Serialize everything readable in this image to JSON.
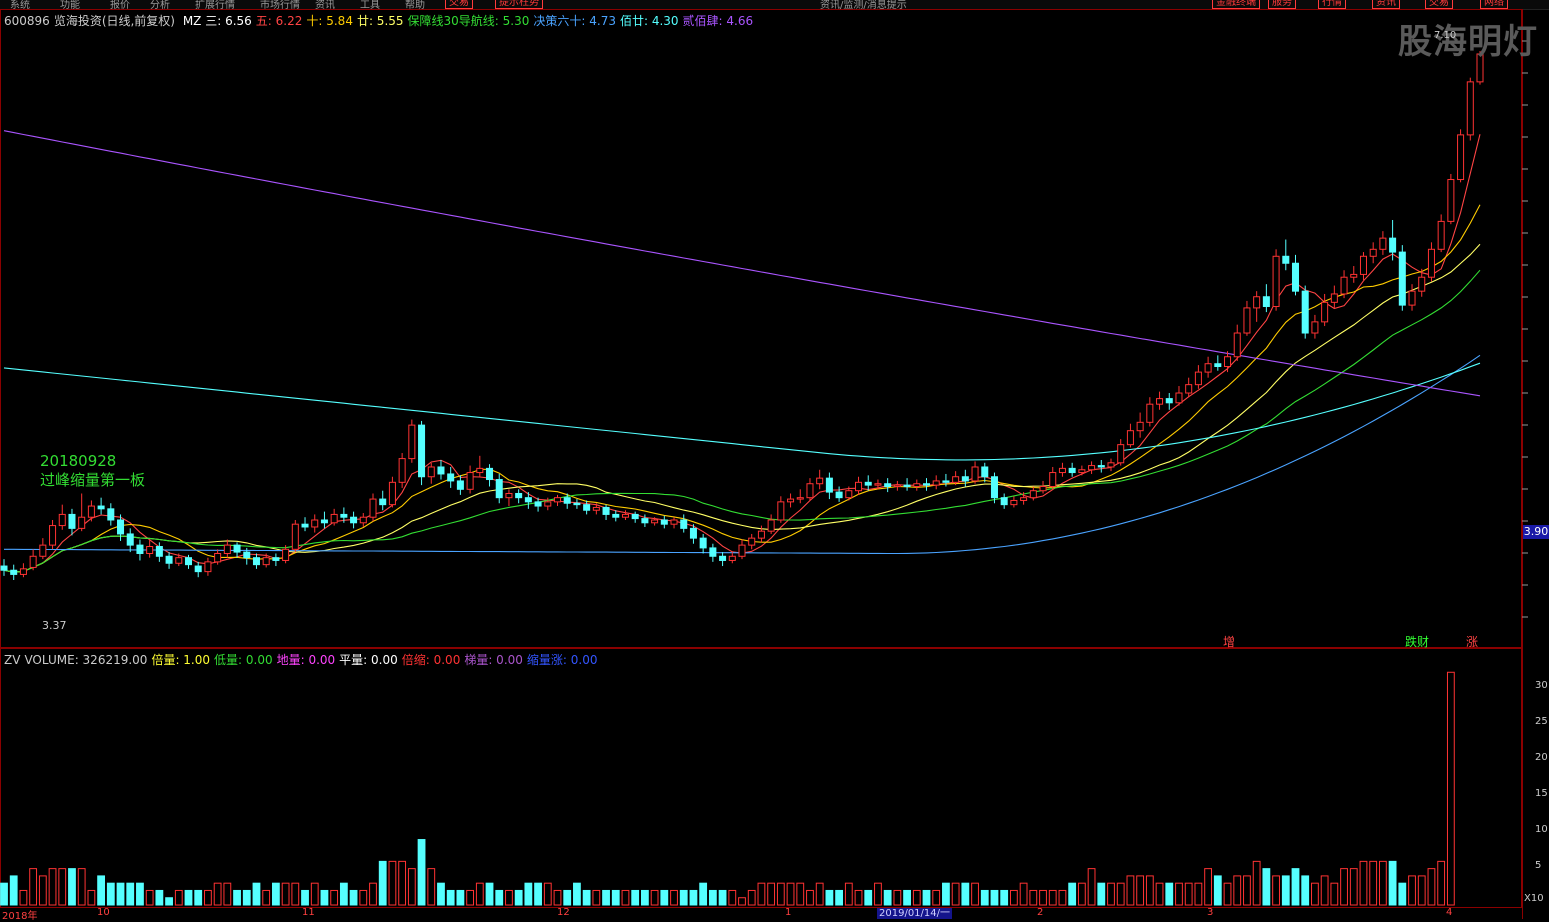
{
  "topbar": {
    "tabs": [
      "系统",
      "功能",
      "报价",
      "分析",
      "扩展行情",
      "市场行情",
      "资讯",
      "工具",
      "帮助",
      "交易",
      "提示柱势"
    ],
    "center_title": "资讯/监测/消息提示",
    "right_buttons": [
      "金融终端",
      "服务",
      "行情",
      "资讯",
      "交易",
      "网络"
    ]
  },
  "header": {
    "code": "600896",
    "name": "览海投资(日线,前复权)",
    "ma_items": [
      {
        "label": "MZ 三:",
        "value": "6.56",
        "color": "#ffffff"
      },
      {
        "label": "五:",
        "value": "6.22",
        "color": "#ff4444"
      },
      {
        "label": "十:",
        "value": "5.84",
        "color": "#ffcc00"
      },
      {
        "label": "廿:",
        "value": "5.55",
        "color": "#ffff66"
      },
      {
        "label": "保障线30导航线:",
        "value": "5.30",
        "color": "#33dd33"
      },
      {
        "label": "决策六十:",
        "value": "4.73",
        "color": "#4aa3ff"
      },
      {
        "label": "佰廿:",
        "value": "4.30",
        "color": "#55ffff"
      },
      {
        "label": "贰佰肆:",
        "value": "4.66",
        "color": "#aa55ff"
      }
    ]
  },
  "volume_header": {
    "items": [
      {
        "label": "ZV",
        "value": "",
        "color": "#cccccc"
      },
      {
        "label": "VOLUME:",
        "value": "326219.00",
        "color": "#cccccc"
      },
      {
        "label": "倍量:",
        "value": "1.00",
        "color": "#ffff33"
      },
      {
        "label": "低量:",
        "value": "0.00",
        "color": "#33dd33"
      },
      {
        "label": "地量:",
        "value": "0.00",
        "color": "#ff44ff"
      },
      {
        "label": "平量:",
        "value": "0.00",
        "color": "#ffffff"
      },
      {
        "label": "倍缩:",
        "value": "0.00",
        "color": "#ff3333"
      },
      {
        "label": "梯量:",
        "value": "0.00",
        "color": "#aa55cc"
      },
      {
        "label": "缩量涨:",
        "value": "0.00",
        "color": "#3355ff"
      }
    ]
  },
  "watermark": "股海明灯",
  "annotation": {
    "date": "20180928",
    "text": "过峰缩量第一板"
  },
  "markers": {
    "low_price": "3.37",
    "high_price": "7.10",
    "current_price": "3.90"
  },
  "signals": [
    {
      "text": "增",
      "color": "#ff4444"
    },
    {
      "text": "跌财",
      "color": "#33ff33"
    },
    {
      "text": "涨",
      "color": "#ff4444"
    }
  ],
  "cursor_date": "2019/01/14/一",
  "x_axis_labels": [
    "2018年",
    "10",
    "11",
    "12",
    "1",
    "2",
    "3",
    "4"
  ],
  "volume_axis": {
    "labels": [
      "5",
      "10",
      "15",
      "20",
      "25",
      "30"
    ],
    "unit": "X10"
  },
  "colors": {
    "up": "#ff3333",
    "down": "#55ffff",
    "grid": "#8b0000",
    "ma5": "#ff4444",
    "ma10": "#ffcc00",
    "ma20": "#ffff66",
    "ma30": "#33dd33",
    "ma60": "#4aa3ff",
    "ma120": "#55ffff",
    "ma240": "#aa55ff"
  },
  "chart_data": {
    "type": "candlestick",
    "title": "600896 览海投资(日线,前复权)",
    "ylim": [
      2.9,
      7.2
    ],
    "candles": [
      [
        3.43,
        3.4,
        3.48,
        3.36
      ],
      [
        3.4,
        3.37,
        3.44,
        3.33
      ],
      [
        3.37,
        3.41,
        3.45,
        3.35
      ],
      [
        3.42,
        3.5,
        3.55,
        3.4
      ],
      [
        3.5,
        3.58,
        3.63,
        3.48
      ],
      [
        3.58,
        3.72,
        3.76,
        3.55
      ],
      [
        3.72,
        3.8,
        3.87,
        3.69
      ],
      [
        3.8,
        3.7,
        3.84,
        3.65
      ],
      [
        3.7,
        3.78,
        3.95,
        3.68
      ],
      [
        3.78,
        3.86,
        3.9,
        3.75
      ],
      [
        3.86,
        3.84,
        3.92,
        3.8
      ],
      [
        3.84,
        3.76,
        3.88,
        3.72
      ],
      [
        3.76,
        3.66,
        3.8,
        3.61
      ],
      [
        3.66,
        3.58,
        3.7,
        3.53
      ],
      [
        3.58,
        3.52,
        3.62,
        3.47
      ],
      [
        3.52,
        3.57,
        3.62,
        3.49
      ],
      [
        3.57,
        3.5,
        3.6,
        3.46
      ],
      [
        3.5,
        3.45,
        3.53,
        3.41
      ],
      [
        3.45,
        3.49,
        3.52,
        3.43
      ],
      [
        3.49,
        3.44,
        3.51,
        3.41
      ],
      [
        3.43,
        3.39,
        3.46,
        3.35
      ],
      [
        3.39,
        3.46,
        3.49,
        3.36
      ],
      [
        3.46,
        3.52,
        3.55,
        3.44
      ],
      [
        3.52,
        3.58,
        3.62,
        3.49
      ],
      [
        3.58,
        3.53,
        3.6,
        3.49
      ],
      [
        3.53,
        3.49,
        3.56,
        3.44
      ],
      [
        3.49,
        3.44,
        3.52,
        3.41
      ],
      [
        3.44,
        3.49,
        3.52,
        3.42
      ],
      [
        3.49,
        3.47,
        3.52,
        3.43
      ],
      [
        3.47,
        3.55,
        3.58,
        3.45
      ],
      [
        3.55,
        3.73,
        3.76,
        3.53
      ],
      [
        3.73,
        3.71,
        3.78,
        3.68
      ],
      [
        3.71,
        3.76,
        3.8,
        3.67
      ],
      [
        3.76,
        3.74,
        3.82,
        3.7
      ],
      [
        3.74,
        3.8,
        3.84,
        3.72
      ],
      [
        3.8,
        3.78,
        3.85,
        3.74
      ],
      [
        3.78,
        3.74,
        3.82,
        3.7
      ],
      [
        3.74,
        3.78,
        3.81,
        3.71
      ],
      [
        3.78,
        3.91,
        3.95,
        3.75
      ],
      [
        3.91,
        3.87,
        3.97,
        3.83
      ],
      [
        3.87,
        4.03,
        4.07,
        3.85
      ],
      [
        4.03,
        4.2,
        4.24,
        3.99
      ],
      [
        4.2,
        4.44,
        4.48,
        4.17
      ],
      [
        4.44,
        4.07,
        4.47,
        4.01
      ],
      [
        4.07,
        4.14,
        4.17,
        4.02
      ],
      [
        4.14,
        4.09,
        4.19,
        4.05
      ],
      [
        4.09,
        4.04,
        4.14,
        3.99
      ],
      [
        4.04,
        3.98,
        4.08,
        3.94
      ],
      [
        3.98,
        4.1,
        4.15,
        3.95
      ],
      [
        4.1,
        4.13,
        4.22,
        4.07
      ],
      [
        4.13,
        4.05,
        4.16,
        4.0
      ],
      [
        4.05,
        3.92,
        4.09,
        3.88
      ],
      [
        3.92,
        3.95,
        3.98,
        3.86
      ],
      [
        3.95,
        3.92,
        3.98,
        3.88
      ],
      [
        3.92,
        3.89,
        3.96,
        3.84
      ],
      [
        3.89,
        3.86,
        3.92,
        3.82
      ],
      [
        3.86,
        3.89,
        3.92,
        3.83
      ],
      [
        3.89,
        3.92,
        3.94,
        3.86
      ],
      [
        3.92,
        3.88,
        3.95,
        3.84
      ],
      [
        3.88,
        3.87,
        3.91,
        3.84
      ],
      [
        3.87,
        3.83,
        3.9,
        3.8
      ],
      [
        3.83,
        3.85,
        3.88,
        3.8
      ],
      [
        3.85,
        3.8,
        3.87,
        3.76
      ],
      [
        3.8,
        3.78,
        3.83,
        3.75
      ],
      [
        3.78,
        3.8,
        3.83,
        3.76
      ],
      [
        3.8,
        3.77,
        3.82,
        3.74
      ],
      [
        3.77,
        3.74,
        3.8,
        3.71
      ],
      [
        3.74,
        3.76,
        3.78,
        3.72
      ],
      [
        3.76,
        3.73,
        3.79,
        3.7
      ],
      [
        3.73,
        3.76,
        3.78,
        3.7
      ],
      [
        3.76,
        3.7,
        3.8,
        3.67
      ],
      [
        3.7,
        3.63,
        3.73,
        3.59
      ],
      [
        3.63,
        3.56,
        3.66,
        3.52
      ],
      [
        3.56,
        3.5,
        3.59,
        3.46
      ],
      [
        3.5,
        3.47,
        3.53,
        3.43
      ],
      [
        3.47,
        3.5,
        3.53,
        3.45
      ],
      [
        3.5,
        3.58,
        3.62,
        3.48
      ],
      [
        3.58,
        3.63,
        3.66,
        3.55
      ],
      [
        3.63,
        3.68,
        3.72,
        3.6
      ],
      [
        3.68,
        3.76,
        3.8,
        3.66
      ],
      [
        3.76,
        3.89,
        3.93,
        3.74
      ],
      [
        3.89,
        3.91,
        3.95,
        3.85
      ],
      [
        3.91,
        3.92,
        3.98,
        3.88
      ],
      [
        3.92,
        4.02,
        4.06,
        3.9
      ],
      [
        4.02,
        4.06,
        4.12,
        3.98
      ],
      [
        4.06,
        3.96,
        4.1,
        3.91
      ],
      [
        3.96,
        3.92,
        4.0,
        3.89
      ],
      [
        3.92,
        3.97,
        4.0,
        3.9
      ],
      [
        3.97,
        4.03,
        4.07,
        3.94
      ],
      [
        4.03,
        4.01,
        4.08,
        3.97
      ],
      [
        4.01,
        4.02,
        4.05,
        3.98
      ],
      [
        4.02,
        4.0,
        4.06,
        3.96
      ],
      [
        4.0,
        4.01,
        4.04,
        3.97
      ],
      [
        4.01,
        4.0,
        4.06,
        3.97
      ],
      [
        4.0,
        4.02,
        4.05,
        3.97
      ],
      [
        4.02,
        4.01,
        4.06,
        3.97
      ],
      [
        4.01,
        4.04,
        4.08,
        3.98
      ],
      [
        4.04,
        4.03,
        4.09,
        4.0
      ],
      [
        4.03,
        4.07,
        4.11,
        4.01
      ],
      [
        4.07,
        4.04,
        4.12,
        4.0
      ],
      [
        4.04,
        4.14,
        4.18,
        4.02
      ],
      [
        4.14,
        4.07,
        4.17,
        4.03
      ],
      [
        4.07,
        3.92,
        4.1,
        3.88
      ],
      [
        3.92,
        3.87,
        3.95,
        3.84
      ],
      [
        3.87,
        3.9,
        3.93,
        3.85
      ],
      [
        3.9,
        3.92,
        3.96,
        3.87
      ],
      [
        3.92,
        3.97,
        4.0,
        3.9
      ],
      [
        3.97,
        4.0,
        4.04,
        3.95
      ],
      [
        4.0,
        4.1,
        4.14,
        3.98
      ],
      [
        4.1,
        4.13,
        4.17,
        4.07
      ],
      [
        4.13,
        4.1,
        4.17,
        4.07
      ],
      [
        4.1,
        4.12,
        4.15,
        4.08
      ],
      [
        4.12,
        4.15,
        4.18,
        4.09
      ],
      [
        4.15,
        4.14,
        4.19,
        4.1
      ],
      [
        4.14,
        4.17,
        4.2,
        4.11
      ],
      [
        4.17,
        4.3,
        4.34,
        4.15
      ],
      [
        4.3,
        4.4,
        4.45,
        4.28
      ],
      [
        4.4,
        4.46,
        4.53,
        4.35
      ],
      [
        4.46,
        4.59,
        4.64,
        4.43
      ],
      [
        4.59,
        4.63,
        4.68,
        4.55
      ],
      [
        4.63,
        4.6,
        4.67,
        4.55
      ],
      [
        4.6,
        4.67,
        4.72,
        4.58
      ],
      [
        4.67,
        4.73,
        4.78,
        4.64
      ],
      [
        4.73,
        4.82,
        4.87,
        4.7
      ],
      [
        4.82,
        4.88,
        4.93,
        4.78
      ],
      [
        4.88,
        4.86,
        4.94,
        4.83
      ],
      [
        4.86,
        4.93,
        4.97,
        4.82
      ],
      [
        4.93,
        5.1,
        5.16,
        4.9
      ],
      [
        5.1,
        5.28,
        5.33,
        5.08
      ],
      [
        5.28,
        5.36,
        5.4,
        5.18
      ],
      [
        5.36,
        5.29,
        5.45,
        5.25
      ],
      [
        5.29,
        5.65,
        5.7,
        5.26
      ],
      [
        5.65,
        5.6,
        5.77,
        5.55
      ],
      [
        5.6,
        5.4,
        5.66,
        5.37
      ],
      [
        5.4,
        5.1,
        5.44,
        5.06
      ],
      [
        5.1,
        5.18,
        5.23,
        5.06
      ],
      [
        5.18,
        5.32,
        5.38,
        5.15
      ],
      [
        5.32,
        5.38,
        5.44,
        5.28
      ],
      [
        5.38,
        5.5,
        5.55,
        5.35
      ],
      [
        5.5,
        5.52,
        5.58,
        5.46
      ],
      [
        5.52,
        5.65,
        5.68,
        5.48
      ],
      [
        5.65,
        5.7,
        5.75,
        5.6
      ],
      [
        5.7,
        5.78,
        5.83,
        5.66
      ],
      [
        5.78,
        5.68,
        5.91,
        5.62
      ],
      [
        5.68,
        5.3,
        5.73,
        5.26
      ],
      [
        5.3,
        5.4,
        5.45,
        5.26
      ],
      [
        5.4,
        5.5,
        5.56,
        5.36
      ],
      [
        5.5,
        5.7,
        5.75,
        5.47
      ],
      [
        5.7,
        5.9,
        5.95,
        5.68
      ],
      [
        5.9,
        6.2,
        6.24,
        5.88
      ],
      [
        6.2,
        6.52,
        6.56,
        6.18
      ],
      [
        6.52,
        6.9,
        6.93,
        6.48
      ],
      [
        6.9,
        7.1,
        7.12,
        6.88
      ]
    ],
    "volume": [
      3,
      4,
      2,
      5,
      4,
      5,
      5,
      5,
      5,
      2,
      4,
      3,
      3,
      3,
      3,
      2,
      2,
      1,
      2,
      2,
      2,
      2,
      3,
      3,
      2,
      2,
      3,
      2,
      3,
      3,
      3,
      2,
      3,
      2,
      2,
      3,
      2,
      2,
      3,
      6,
      6,
      6,
      5,
      9,
      5,
      3,
      2,
      2,
      2,
      3,
      3,
      2,
      2,
      2,
      3,
      3,
      3,
      2,
      2,
      3,
      2,
      2,
      2,
      2,
      2,
      2,
      2,
      2,
      2,
      2,
      2,
      2,
      3,
      2,
      2,
      2,
      1,
      2,
      3,
      3,
      3,
      3,
      3,
      2,
      3,
      2,
      2,
      3,
      2,
      2,
      3,
      2,
      2,
      2,
      2,
      2,
      2,
      3,
      3,
      3,
      3,
      2,
      2,
      2,
      2,
      3,
      2,
      2,
      2,
      2,
      3,
      3,
      5,
      3,
      3,
      3,
      4,
      4,
      4,
      3,
      3,
      3,
      3,
      3,
      5,
      4,
      3,
      4,
      4,
      6,
      5,
      4,
      4,
      5,
      4,
      3,
      4,
      3,
      5,
      5,
      6,
      6,
      6,
      6,
      3,
      4,
      4,
      5,
      6,
      32
    ],
    "x": [
      "2018年",
      "10",
      "11",
      "12",
      "1",
      "2",
      "3",
      "4"
    ],
    "y_unit": "X10",
    "volume_ylim": [
      0,
      33
    ]
  }
}
